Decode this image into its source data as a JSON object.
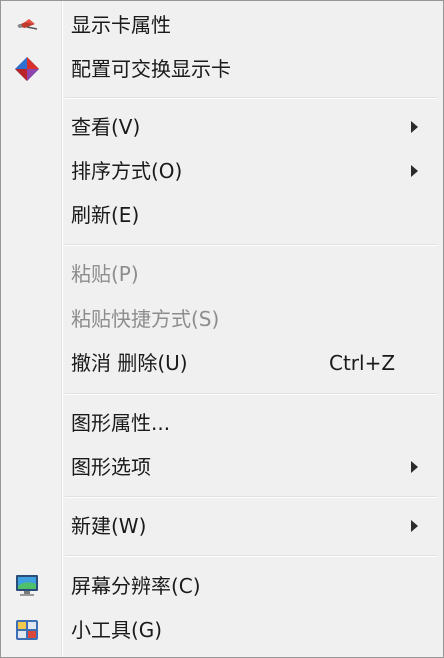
{
  "menu": {
    "items": [
      {
        "label": "显示卡属性",
        "icon": "graphics-card-icon"
      },
      {
        "label": "配置可交换显示卡",
        "icon": "switchable-graphics-icon"
      },
      {
        "label": "查看(V)",
        "submenu": true
      },
      {
        "label": "排序方式(O)",
        "submenu": true
      },
      {
        "label": "刷新(E)"
      },
      {
        "label": "粘贴(P)",
        "disabled": true
      },
      {
        "label": "粘贴快捷方式(S)",
        "disabled": true
      },
      {
        "label": "撤消 删除(U)",
        "shortcut": "Ctrl+Z"
      },
      {
        "label": "图形属性..."
      },
      {
        "label": "图形选项",
        "submenu": true
      },
      {
        "label": "新建(W)",
        "submenu": true
      },
      {
        "label": "屏幕分辨率(C)",
        "icon": "monitor-icon"
      },
      {
        "label": "小工具(G)",
        "icon": "gadgets-icon"
      }
    ]
  },
  "colors": {
    "menu_bg": "#f0f0f0",
    "text": "#1a1a1a",
    "disabled_text": "#8d8d8d",
    "border": "#979797"
  }
}
